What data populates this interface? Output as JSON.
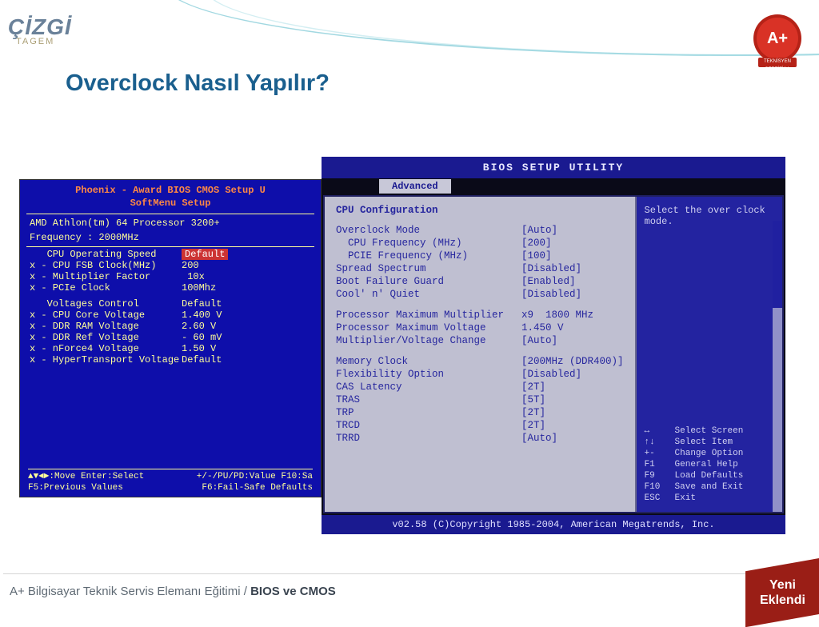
{
  "logo": {
    "main": "ÇİZGİ",
    "sub": "TAGEM"
  },
  "badge": {
    "text": "A+",
    "ribbon": "TEKNİSYEN SERTİFİKA"
  },
  "title": "Overclock Nasıl Yapılır?",
  "left_bios": {
    "header1": "Phoenix - Award BIOS CMOS Setup U",
    "header2": "SoftMenu Setup",
    "cpu_line": "AMD Athlon(tm) 64 Processor 3200+",
    "freq_line": "Frequency  : 2000MHz",
    "rows1": [
      {
        "label": "   CPU Operating Speed",
        "value": "Default",
        "hl": true
      },
      {
        "label": "x - CPU FSB Clock(MHz)",
        "value": "200"
      },
      {
        "label": "x - Multiplier Factor",
        "value": " 10x"
      },
      {
        "label": "x - PCIe Clock",
        "value": "100Mhz"
      }
    ],
    "rows2": [
      {
        "label": "   Voltages Control",
        "value": "Default"
      },
      {
        "label": "x - CPU Core Voltage",
        "value": "1.400 V"
      },
      {
        "label": "x - DDR RAM Voltage",
        "value": "2.60 V"
      },
      {
        "label": "x - DDR Ref Voltage",
        "value": "- 60 mV"
      },
      {
        "label": "x - nForce4 Voltage",
        "value": "1.50 V"
      },
      {
        "label": "x - HyperTransport Voltage",
        "value": "Default"
      }
    ],
    "nav": {
      "l1a": "▲▼◄►:Move  Enter:Select",
      "l1b": "+/-/PU/PD:Value  F10:Sa",
      "l2a": "F5:Previous Values",
      "l2b": "F6:Fail-Safe Defaults"
    }
  },
  "right_bios": {
    "title": "BIOS SETUP UTILITY",
    "tab": "Advanced",
    "heading": "CPU Configuration",
    "rows": [
      {
        "label": "Overclock Mode",
        "value": "[Auto]"
      },
      {
        "label": "  CPU Frequency (MHz)",
        "value": "[200]"
      },
      {
        "label": "  PCIE Frequency (MHz)",
        "value": "[100]"
      },
      {
        "label": "Spread Spectrum",
        "value": "[Disabled]"
      },
      {
        "label": "Boot Failure Guard",
        "value": "[Enabled]"
      },
      {
        "label": "Cool' n' Quiet",
        "value": "[Disabled]"
      },
      {
        "gap": true
      },
      {
        "label": "Processor Maximum Multiplier",
        "value": "x9  1800 MHz"
      },
      {
        "label": "Processor Maximum Voltage",
        "value": "1.450 V"
      },
      {
        "label": "Multiplier/Voltage Change",
        "value": "[Auto]"
      },
      {
        "gap": true
      },
      {
        "label": "Memory Clock",
        "value": "[200MHz (DDR400)]"
      },
      {
        "label": "Flexibility Option",
        "value": "[Disabled]"
      },
      {
        "label": "CAS Latency",
        "value": "[2T]"
      },
      {
        "label": "TRAS",
        "value": "[5T]"
      },
      {
        "label": "TRP",
        "value": "[2T]"
      },
      {
        "label": "TRCD",
        "value": "[2T]"
      },
      {
        "label": "TRRD",
        "value": "[Auto]"
      }
    ],
    "help": "Select the over clock mode.",
    "keys": [
      {
        "k": "↔",
        "d": "Select Screen"
      },
      {
        "k": "↑↓",
        "d": "Select Item"
      },
      {
        "k": "+-",
        "d": "Change Option"
      },
      {
        "k": "F1",
        "d": "General Help"
      },
      {
        "k": "F9",
        "d": "Load Defaults"
      },
      {
        "k": "F10",
        "d": "Save and Exit"
      },
      {
        "k": "ESC",
        "d": "Exit"
      }
    ],
    "footer": "v02.58 (C)Copyright 1985-2004, American Megatrends, Inc."
  },
  "footer": {
    "prefix": "A+ Bilgisayar Teknik Servis Elemanı Eğitimi / ",
    "bold": "BIOS ve CMOS"
  },
  "new_badge": "Yeni\nEklendi"
}
